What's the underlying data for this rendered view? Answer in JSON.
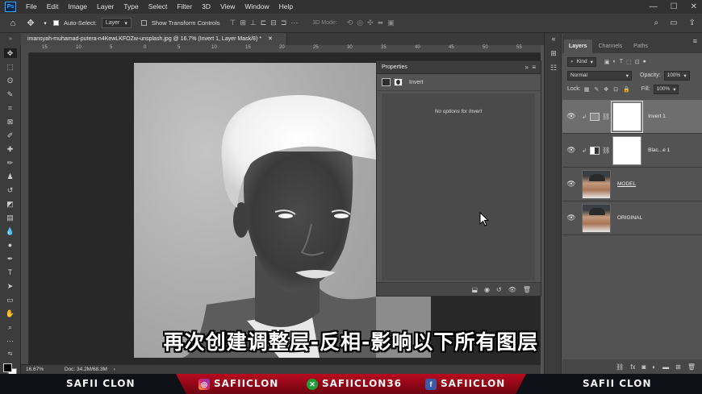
{
  "app": {
    "logo_text": "Ps",
    "menu": [
      "File",
      "Edit",
      "Image",
      "Layer",
      "Type",
      "Select",
      "Filter",
      "3D",
      "View",
      "Window",
      "Help"
    ]
  },
  "options_bar": {
    "auto_select_label": "Auto-Select:",
    "auto_select_value": "Layer",
    "show_transform_label": "Show Transform Controls",
    "mode_3d_label": "3D Mode:"
  },
  "document": {
    "tab_title": "imansyah-muhamad-putera-n4KewLKFOZw-unsplash.jpg @ 16.7% (Invert 1, Layer Mask/8) *",
    "zoom": "16.67%",
    "doc_info": "Doc: 34.2M/68.3M",
    "ruler_ticks": [
      "15",
      "10",
      "5",
      "0",
      "5",
      "10",
      "15",
      "20",
      "25",
      "30",
      "35",
      "40",
      "45",
      "50",
      "55"
    ]
  },
  "properties": {
    "title": "Properties",
    "type_label": "Invert",
    "message": "No options for Invert"
  },
  "layers_panel": {
    "tabs": [
      "Layers",
      "Channels",
      "Paths"
    ],
    "kind_label": "Kind",
    "blend_mode": "Normal",
    "opacity_label": "Opacity:",
    "opacity_value": "100%",
    "lock_label": "Lock:",
    "fill_label": "Fill:",
    "fill_value": "100%",
    "layers": [
      {
        "name": "Invert 1",
        "type": "invert-adjustment",
        "selected": true
      },
      {
        "name": "Blac...e 1",
        "type": "bw-adjustment",
        "selected": false
      },
      {
        "name": "MODEL",
        "type": "photo",
        "selected": false
      },
      {
        "name": "ORIGINAL",
        "type": "photo",
        "selected": false
      }
    ]
  },
  "subtitle": "再次创建调整层-反相-影响以下所有图层",
  "banner": {
    "left_name": "SAFII CLON",
    "instagram": "SAFIICLON",
    "xbox": "SAFIICLON36",
    "facebook": "SAFIICLON",
    "right_name": "SAFII CLON"
  },
  "colors": {
    "accent": "#31a8ff",
    "banner_red": "#b80a1e",
    "panel_bg": "#535353"
  }
}
